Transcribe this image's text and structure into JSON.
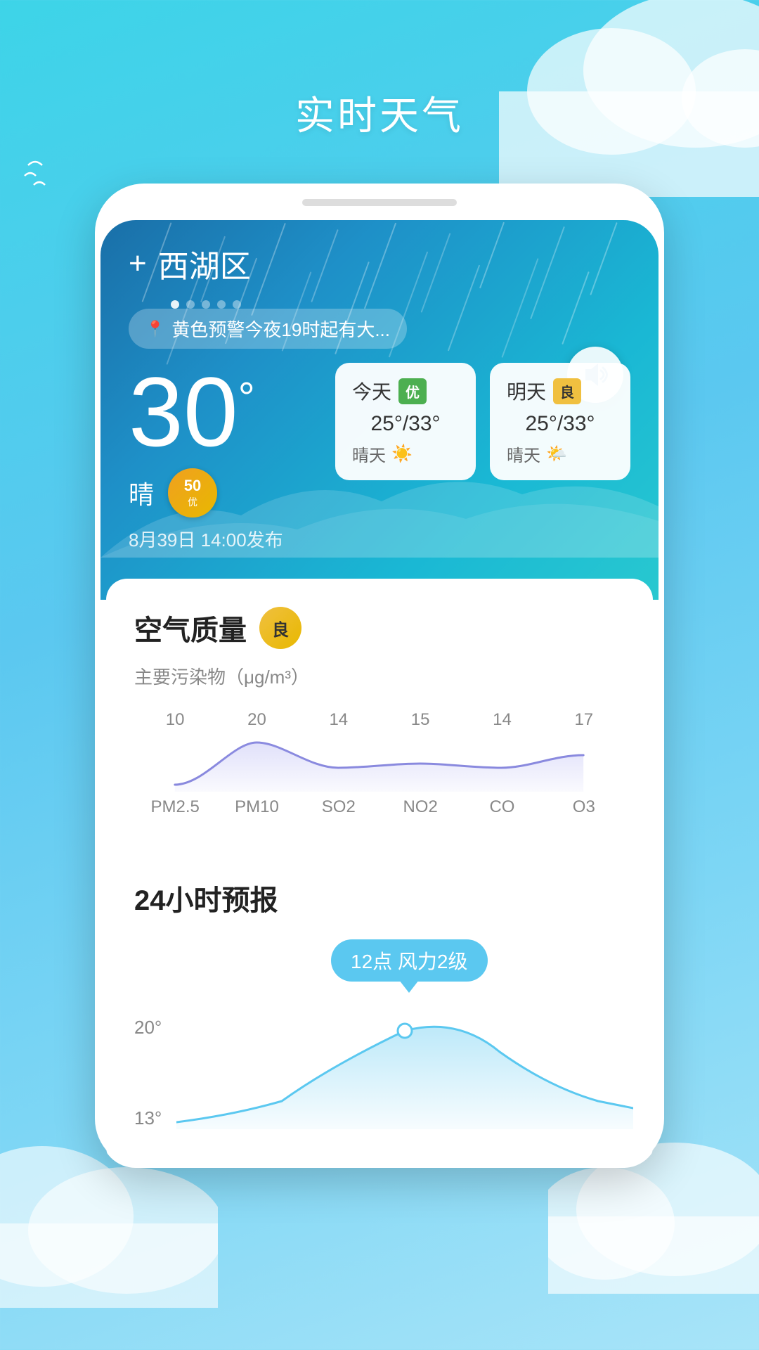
{
  "page": {
    "title": "实时天气",
    "bg_gradient_start": "#3dd4e8",
    "bg_gradient_end": "#7dd6f5"
  },
  "location": {
    "name": "西湖区",
    "plus_label": "+",
    "dots": [
      true,
      false,
      false,
      false,
      false
    ]
  },
  "current_weather": {
    "temperature": "30",
    "degree_symbol": "°",
    "condition": "晴",
    "aqi_value": "50",
    "aqi_unit": "优",
    "publish_time": "8月39日 14:00发布",
    "alert_text": "黄色预警今夜19时起有大..."
  },
  "forecast": {
    "today": {
      "label": "今天",
      "quality": "优",
      "quality_class": "good",
      "temp_range": "25°/33°",
      "condition": "晴天",
      "condition_icon": "☀️"
    },
    "tomorrow": {
      "label": "明天",
      "quality": "良",
      "quality_class": "ok",
      "temp_range": "25°/33°",
      "condition": "晴天",
      "condition_icon": "🌤️"
    }
  },
  "air_quality": {
    "section_title": "空气质量",
    "quality_label": "良",
    "pollutant_label": "主要污染物（μg/m³）",
    "chart_values": [
      "10",
      "20",
      "14",
      "15",
      "14",
      "17"
    ],
    "chart_labels": [
      "PM2.5",
      "PM10",
      "SO2",
      "NO2",
      "CO",
      "O3"
    ],
    "line_color": "#8888dd"
  },
  "forecast_24h": {
    "section_title": "24小时预报",
    "tooltip_text": "12点 风力2级",
    "tooltip_dot_temp": "20°",
    "temp_axis": {
      "high": "20°",
      "low": "13°"
    }
  }
}
